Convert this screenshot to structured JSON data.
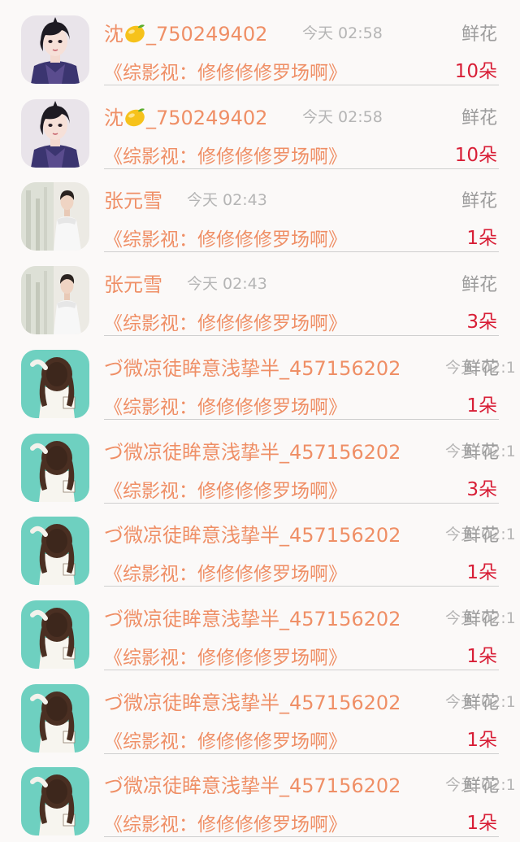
{
  "items": [
    {
      "avatar": "avatar-warrior",
      "name": "沈",
      "name_suffix": "_750249402",
      "has_lemon": true,
      "time": "今天 02:58",
      "gift": "鲜花",
      "title": "《综影视：修修修修罗场啊》",
      "count": "10朵"
    },
    {
      "avatar": "avatar-warrior",
      "name": "沈",
      "name_suffix": "_750249402",
      "has_lemon": true,
      "time": "今天 02:58",
      "gift": "鲜花",
      "title": "《综影视：修修修修罗场啊》",
      "count": "10朵"
    },
    {
      "avatar": "avatar-man",
      "name": "张元雪",
      "name_suffix": "",
      "has_lemon": false,
      "time": "今天 02:43",
      "gift": "鲜花",
      "title": "《综影视：修修修修罗场啊》",
      "count": "1朵"
    },
    {
      "avatar": "avatar-man",
      "name": "张元雪",
      "name_suffix": "",
      "has_lemon": false,
      "time": "今天 02:43",
      "gift": "鲜花",
      "title": "《综影视：修修修修罗场啊》",
      "count": "3朵"
    },
    {
      "avatar": "avatar-girl",
      "name": "づ微凉徒眸意浅挚半_457156202",
      "name_suffix": "",
      "has_lemon": false,
      "time": "今天 02:1",
      "gift": "鲜花",
      "title": "《综影视：修修修修罗场啊》",
      "count": "1朵"
    },
    {
      "avatar": "avatar-girl",
      "name": "づ微凉徒眸意浅挚半_457156202",
      "name_suffix": "",
      "has_lemon": false,
      "time": "今天 02:1",
      "gift": "鲜花",
      "title": "《综影视：修修修修罗场啊》",
      "count": "3朵"
    },
    {
      "avatar": "avatar-girl",
      "name": "づ微凉徒眸意浅挚半_457156202",
      "name_suffix": "",
      "has_lemon": false,
      "time": "今天 02:1",
      "gift": "鲜花",
      "title": "《综影视：修修修修罗场啊》",
      "count": "1朵"
    },
    {
      "avatar": "avatar-girl",
      "name": "づ微凉徒眸意浅挚半_457156202",
      "name_suffix": "",
      "has_lemon": false,
      "time": "今天 02:1",
      "gift": "鲜花",
      "title": "《综影视：修修修修罗场啊》",
      "count": "1朵"
    },
    {
      "avatar": "avatar-girl",
      "name": "づ微凉徒眸意浅挚半_457156202",
      "name_suffix": "",
      "has_lemon": false,
      "time": "今天 02:1",
      "gift": "鲜花",
      "title": "《综影视：修修修修罗场啊》",
      "count": "1朵"
    },
    {
      "avatar": "avatar-girl",
      "name": "づ微凉徒眸意浅挚半_457156202",
      "name_suffix": "",
      "has_lemon": false,
      "time": "今天 02:1",
      "gift": "鲜花",
      "title": "《综影视：修修修修罗场啊》",
      "count": "1朵"
    }
  ],
  "colors": {
    "accent": "#ef8f66",
    "count": "#d81e36",
    "muted": "#9c9c9c",
    "background": "#fbf9f8"
  }
}
